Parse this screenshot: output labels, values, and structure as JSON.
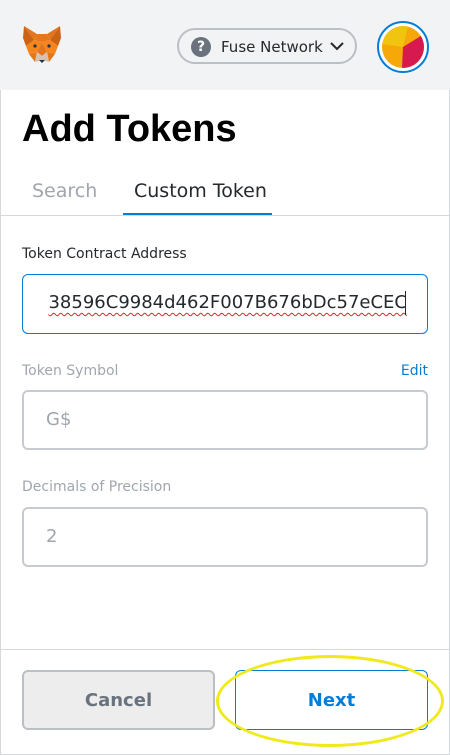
{
  "header": {
    "network_name": "Fuse Network",
    "network_help_glyph": "?",
    "logo_icon": "metamask-fox-icon",
    "account_icon": "account-avatar-icon"
  },
  "page": {
    "title": "Add Tokens"
  },
  "tabs": [
    {
      "label": "Search",
      "active": false
    },
    {
      "label": "Custom Token",
      "active": true
    }
  ],
  "form": {
    "contract_address": {
      "label": "Token Contract Address",
      "value": "38596C9984d462F007B676bDc57eCEC"
    },
    "token_symbol": {
      "label": "Token Symbol",
      "edit_label": "Edit",
      "value": "G$"
    },
    "decimals": {
      "label": "Decimals of Precision",
      "value": "2"
    }
  },
  "footer": {
    "cancel_label": "Cancel",
    "next_label": "Next"
  },
  "colors": {
    "accent": "#037dd6",
    "highlight": "#f0ea1a",
    "muted": "#9fa6ae",
    "spellcheck": "#d9262b"
  }
}
